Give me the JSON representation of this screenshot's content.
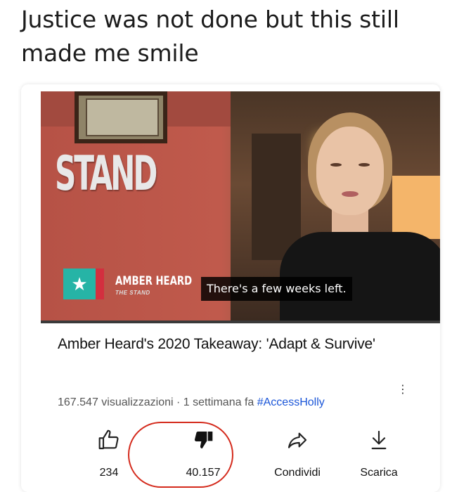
{
  "post": {
    "caption": "Justice was not done but this still made me smile"
  },
  "video": {
    "logo_text": "STAND",
    "lower_third": {
      "name": "AMBER HEARD",
      "org": "THE STAND"
    },
    "subtitle": "There's a few weeks left.",
    "progress_fraction": 0.0
  },
  "details": {
    "title": "Amber Heard's 2020 Takeaway: 'Adapt & Survive'",
    "views": "167.547 visualizzazioni",
    "separator": "·",
    "age": "1 settimana fa",
    "hashtag": "#AccessHolly"
  },
  "actions": {
    "like_count": "234",
    "dislike_count": "40.157",
    "share_label": "Condividi",
    "download_label": "Scarica"
  },
  "colors": {
    "highlight_circle": "#d42a1c",
    "hashtag": "#1a55d8",
    "brand_teal": "#26b4a6"
  },
  "icons": {
    "like": "thumbs-up-outline-icon",
    "dislike": "thumbs-down-filled-icon",
    "share": "share-arrow-icon",
    "download": "download-arrow-icon",
    "more": "more-vertical-icon",
    "channel": "star-icon"
  }
}
